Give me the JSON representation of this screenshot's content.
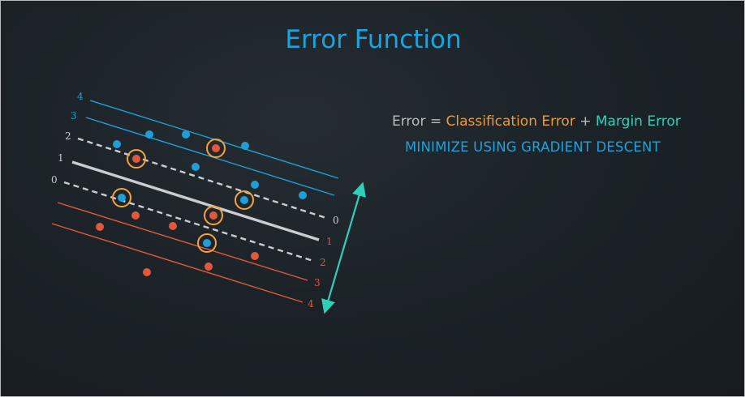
{
  "title": "Error Function",
  "formula": {
    "error_label": "Error",
    "equals": "=",
    "classification_error": "Classification Error",
    "plus": "+",
    "margin_error": "Margin Error"
  },
  "subtitle": "MINIMIZE USING GRADIENT DESCENT",
  "colors": {
    "title": "#1aa4e0",
    "blue_line": "#1f9fd8",
    "red_line": "#e2583e",
    "grey_line": "#c8cdd2",
    "orange_ring": "#f5a33a",
    "arrow": "#2ed1b8"
  },
  "diagram": {
    "left_labels": [
      "4",
      "3",
      "2",
      "1",
      "0"
    ],
    "right_labels": [
      "0",
      "1",
      "2",
      "3",
      "4"
    ]
  }
}
